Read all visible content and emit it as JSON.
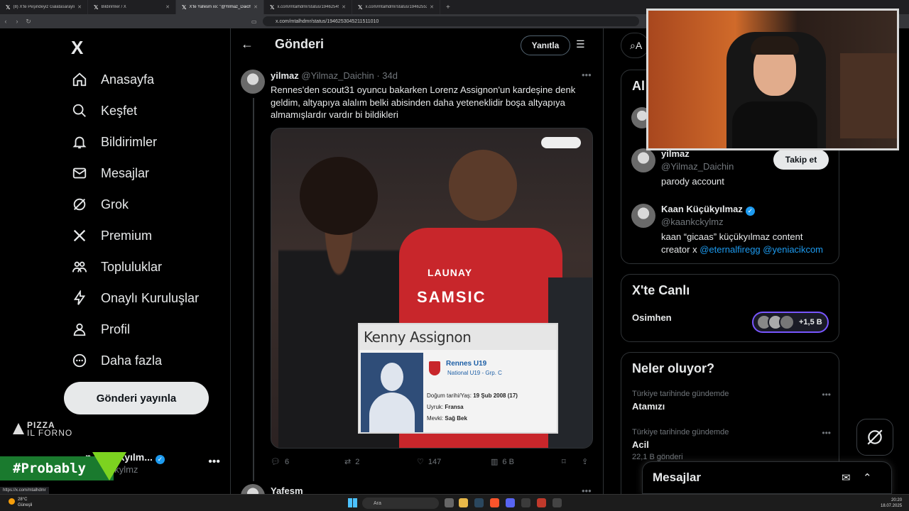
{
  "browser": {
    "tabs": [
      {
        "label": "(8) X'te Peşindeyiz Galatasarayli: \"All T",
        "active": false
      },
      {
        "label": "Bildirimler / X",
        "active": false
      },
      {
        "label": "X'te Yafesm xx: \"@Yilmaz_Daichin",
        "active": true
      },
      {
        "label": "x.com/mtalhdmr/status/1946254531",
        "active": false
      },
      {
        "label": "x.com/mtalhdmr/status/1946255201",
        "active": false
      }
    ],
    "new_tab": "+",
    "url": "x.com/mtalhdmr/status/1946253045211511010",
    "status_url": "https://x.com/mtalhdmr"
  },
  "sidebar": {
    "logo": "X",
    "nav": [
      {
        "label": "Anasayfa",
        "icon": "home-icon"
      },
      {
        "label": "Keşfet",
        "icon": "search-icon"
      },
      {
        "label": "Bildirimler",
        "icon": "bell-icon"
      },
      {
        "label": "Mesajlar",
        "icon": "mail-icon"
      },
      {
        "label": "Grok",
        "icon": "grok-icon"
      },
      {
        "label": "Premium",
        "icon": "x-icon"
      },
      {
        "label": "Topluluklar",
        "icon": "people-icon"
      },
      {
        "label": "Onaylı Kuruluşlar",
        "icon": "lightning-icon"
      },
      {
        "label": "Profil",
        "icon": "person-icon"
      },
      {
        "label": "Daha fazla",
        "icon": "more-circle-icon"
      }
    ],
    "post_button": "Gönderi yayınla",
    "brand_line1": "PIZZA",
    "brand_line2": "IL FORNO",
    "account_name": "n Küçükyılm...",
    "account_handle": "kaankckylmz",
    "overlay_tag": "#Probably"
  },
  "main": {
    "title": "Gönderi",
    "reply_button": "Yanıtla",
    "tweet": {
      "name": "yilmaz",
      "handle": "@Yilmaz_Daichin",
      "time": "· 34d",
      "text": "Rennes'den scout31 oyuncu bakarken Lorenz Assignon'un kardeşine denk geldim, altyapıya alalım belki abisinden daha yeteneklidir boşa altyapıya almamışlardır vardır bi bildikleri",
      "image": {
        "shirt_text1": "LAUNAY",
        "shirt_text2": "SAMSIC",
        "card_name": "Kenny Assignon",
        "card_club": "Rennes U19",
        "card_league": "National U19 - Grp. C",
        "dob_label": "Doğum tarihi/Yaş:",
        "dob_value": "19 Şub 2008 (17)",
        "nat_label": "Uyruk:",
        "nat_value": "Fransa",
        "pos_label": "Mevki:",
        "pos_value": "Sağ Bek"
      },
      "replies": "6",
      "reposts": "2",
      "likes": "147",
      "views": "6 B"
    },
    "next_tweet_name": "Yafesm"
  },
  "right": {
    "search_placeholder": "A",
    "related_title": "Al",
    "users": [
      {
        "name": "yilmaz",
        "handle": "@Yilmaz_Daichin",
        "bio": "parody account",
        "follow": "Takip et"
      },
      {
        "name": "Kaan Küçükyılmaz",
        "handle": "@kaankckylmz",
        "bio_text": "kaan “gicaas” küçükyılmaz content creator x ",
        "bio_link1": "@eternalfiregg",
        "bio_link2": "@yeniacikcom"
      }
    ],
    "live_title": "X'te Canlı",
    "live_name": "Osimhen",
    "live_count": "+1,5 B",
    "trending_title": "Neler oluyor?",
    "trends": [
      {
        "context": "Türkiye tarihinde gündemde",
        "title": "Atamızı",
        "count": ""
      },
      {
        "context": "Türkiye tarihinde gündemde",
        "title": "Acil",
        "count": "22,1 B gönderi"
      }
    ],
    "messages_title": "Mesajlar"
  },
  "taskbar": {
    "weather_temp": "28°C",
    "weather_desc": "Güneşli",
    "search_text": "Ara",
    "time": "20:20",
    "date": "18.07.2025"
  },
  "colors": {
    "accent": "#1d9bf0",
    "background": "#000000",
    "text": "#e7e9ea",
    "muted": "#71767b",
    "live_border": "#7856ff",
    "overlay_green": "#1a7a2e"
  }
}
